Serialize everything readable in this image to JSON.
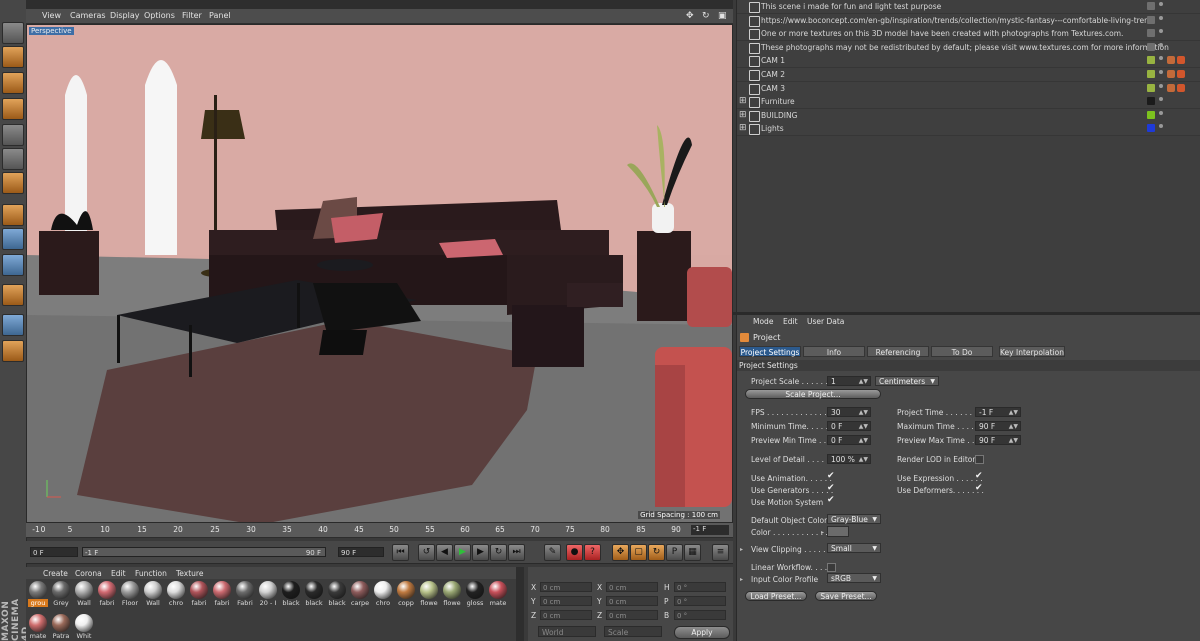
{
  "app": {
    "logo": "MAXON CINEMA 4D"
  },
  "viewport": {
    "menu": [
      "View",
      "Cameras",
      "Display",
      "Options",
      "Filter",
      "Panel"
    ],
    "label": "Perspective",
    "grid_spacing": "Grid Spacing : 100 cm"
  },
  "timeline": {
    "ticks": [
      "-1",
      "0",
      "5",
      "10",
      "15",
      "20",
      "25",
      "30",
      "35",
      "40",
      "45",
      "50",
      "55",
      "60",
      "65",
      "70",
      "75",
      "80",
      "85",
      "90"
    ],
    "current_frame": "-1 F"
  },
  "transport": {
    "start": "0 F",
    "range_start": "-1 F",
    "range_end": "90 F",
    "end": "90 F"
  },
  "materials": {
    "menu": [
      "Create",
      "Corona",
      "Edit",
      "Function",
      "Texture"
    ],
    "items": [
      {
        "label": "grou",
        "color": "#7b7b7b",
        "selected": true
      },
      {
        "label": "Grey",
        "color": "#6a6a6a"
      },
      {
        "label": "Wall",
        "color": "#b0b0b0"
      },
      {
        "label": "fabri",
        "color": "#d26a72"
      },
      {
        "label": "Floor",
        "color": "#9c9c9c"
      },
      {
        "label": "Wall",
        "color": "#cfcfcf"
      },
      {
        "label": "chro",
        "color": "#dddddd"
      },
      {
        "label": "fabri",
        "color": "#b0545a"
      },
      {
        "label": "fabri",
        "color": "#cc6a70"
      },
      {
        "label": "Fabri",
        "color": "#6c6c6c"
      },
      {
        "label": "20 - I",
        "color": "#d2d2d2"
      },
      {
        "label": "black",
        "color": "#1e1e1e"
      },
      {
        "label": "black",
        "color": "#2a2a2a"
      },
      {
        "label": "black",
        "color": "#3a3a3a"
      },
      {
        "label": "carpe",
        "color": "#8e5c5c"
      },
      {
        "label": "chro",
        "color": "#eeeeee"
      },
      {
        "label": "copp",
        "color": "#c07a40"
      },
      {
        "label": "flowe",
        "color": "#b8c28a"
      },
      {
        "label": "flowe",
        "color": "#9aa874"
      },
      {
        "label": "gloss",
        "color": "#222222"
      },
      {
        "label": "mate",
        "color": "#c8505a"
      },
      {
        "label": "mate",
        "color": "#d06e6e"
      },
      {
        "label": "Patra",
        "color": "#9a6a5a"
      },
      {
        "label": "Whit",
        "color": "#f0f0f0"
      }
    ]
  },
  "coordinates": {
    "rows": [
      {
        "a": "X",
        "av": "0 cm",
        "b": "X",
        "bv": "0 cm",
        "c": "H",
        "cv": "0 °"
      },
      {
        "a": "Y",
        "av": "0 cm",
        "b": "Y",
        "bv": "0 cm",
        "c": "P",
        "cv": "0 °"
      },
      {
        "a": "Z",
        "av": "0 cm",
        "b": "Z",
        "bv": "0 cm",
        "c": "B",
        "cv": "0 °"
      }
    ],
    "space": "World",
    "mode": "Scale",
    "apply": "Apply"
  },
  "objects": {
    "rows": [
      {
        "name": "This scene i made for fun and light test purpose",
        "group": false
      },
      {
        "name": "https://www.boconcept.com/en-gb/inspiration/trends/collection/mystic-fantasy---comfortable-living-trend",
        "group": false
      },
      {
        "name": "One or more textures on this 3D model have been created with photographs from Textures.com.",
        "group": false
      },
      {
        "name": "These photographs may not be redistributed by default; please visit www.textures.com for more information",
        "group": false
      },
      {
        "name": "CAM 1",
        "group": false,
        "camera": true,
        "layer": "#98b341"
      },
      {
        "name": "CAM 2",
        "group": false,
        "camera": true,
        "layer": "#98b341"
      },
      {
        "name": "CAM 3",
        "group": false,
        "camera": true,
        "layer": "#98b341"
      },
      {
        "name": "Furniture",
        "group": true,
        "layer": "#1b1b1b"
      },
      {
        "name": "BUILDING",
        "group": true,
        "layer": "#7cc11e"
      },
      {
        "name": "Lights",
        "group": true,
        "layer": "#1e3ad8"
      }
    ]
  },
  "attributes": {
    "menu": [
      "Mode",
      "Edit",
      "User Data"
    ],
    "title": "Project",
    "tabs": [
      "Project Settings",
      "Info",
      "Referencing",
      "To Do",
      "Key Interpolation"
    ],
    "section": "Project Settings",
    "project_scale_label": "Project Scale . . . . . .",
    "project_scale_value": "1",
    "project_scale_unit": "Centimeters",
    "scale_project_button": "Scale Project...",
    "fps_label": "FPS . . . . . . . . . . . . . .",
    "fps_value": "30",
    "project_time_label": "Project Time . . . . . . . .",
    "project_time_value": "-1 F",
    "min_time_label": "Minimum Time. . . . . .",
    "min_time_value": "0 F",
    "max_time_label": "Maximum Time . . . . . .",
    "max_time_value": "90 F",
    "preview_min_label": "Preview Min Time . .",
    "preview_min_value": "0 F",
    "preview_max_label": "Preview Max Time . .",
    "preview_max_value": "90 F",
    "lod_label": "Level of Detail . . . . .",
    "lod_value": "100 %",
    "render_lod_label": "Render LOD in Editor",
    "use_animation_label": "Use Animation. . . . . .",
    "use_expression_label": "Use Expression . . . . . .",
    "use_generators_label": "Use Generators . . . . .",
    "use_deformers_label": "Use Deformers. . . . . . .",
    "use_motion_label": "Use Motion System",
    "default_color_label": "Default Object Color",
    "default_color_value": "Gray-Blue",
    "color_label": "Color . . . . . . . . . . . .",
    "view_clipping_label": "View Clipping . . . . . . .",
    "view_clipping_value": "Small",
    "linear_workflow_label": "Linear Workflow. . . . .",
    "input_profile_label": "Input Color Profile",
    "input_profile_value": "sRGB",
    "load_preset": "Load Preset...",
    "save_preset": "Save Preset..."
  }
}
